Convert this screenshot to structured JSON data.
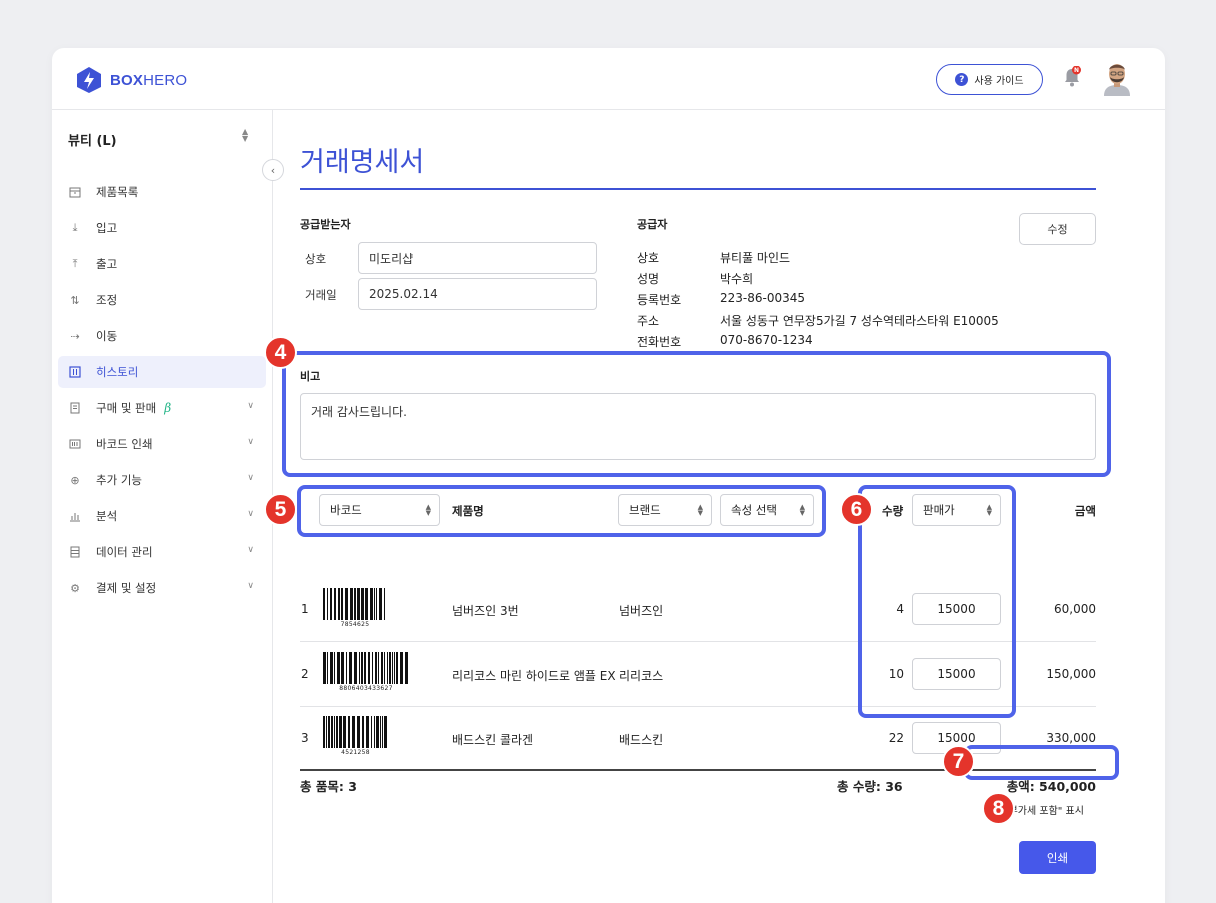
{
  "app": {
    "logo_bold": "BOX",
    "logo_light": "HERO"
  },
  "header": {
    "guide_label": "사용 가이드",
    "notification_badge": "N"
  },
  "sidebar": {
    "store": "뷰티 (L)",
    "items": [
      {
        "label": "제품목록",
        "icon": "box-icon"
      },
      {
        "label": "입고",
        "icon": "arrow-down-icon"
      },
      {
        "label": "출고",
        "icon": "arrow-up-icon"
      },
      {
        "label": "조정",
        "icon": "adjust-icon"
      },
      {
        "label": "이동",
        "icon": "move-icon"
      },
      {
        "label": "히스토리",
        "icon": "history-icon",
        "active": true
      },
      {
        "label": "구매 및 판매",
        "icon": "document-icon",
        "beta": "β",
        "expand": true
      },
      {
        "label": "바코드 인쇄",
        "icon": "barcode-icon",
        "expand": true
      },
      {
        "label": "추가 기능",
        "icon": "plus-circle-icon",
        "expand": true
      },
      {
        "label": "분석",
        "icon": "chart-icon",
        "expand": true
      },
      {
        "label": "데이터 관리",
        "icon": "database-icon",
        "expand": true
      },
      {
        "label": "결제 및 설정",
        "icon": "settings-icon",
        "expand": true
      }
    ]
  },
  "page": {
    "title": "거래명세서",
    "receiver": {
      "section_label": "공급받는자",
      "name_label": "상호",
      "name_value": "미도리샵",
      "date_label": "거래일",
      "date_value": "2025.02.14"
    },
    "supplier": {
      "section_label": "공급자",
      "edit_label": "수정",
      "rows": [
        {
          "k": "상호",
          "v": "뷰티풀 마인드"
        },
        {
          "k": "성명",
          "v": "박수희"
        },
        {
          "k": "등록번호",
          "v": "223-86-00345"
        },
        {
          "k": "주소",
          "v": "서울 성동구 연무장5가길 7 성수역테라스타워 E10005"
        },
        {
          "k": "전화번호",
          "v": "070-8670-1234"
        }
      ]
    },
    "memo": {
      "label": "비고",
      "value": "거래 감사드립니다."
    },
    "table": {
      "barcode_select": "바코드",
      "product_header": "제품명",
      "brand_select": "브랜드",
      "attr_select": "속성 선택",
      "qty_header": "수량",
      "price_select": "판매가",
      "amount_header": "금액",
      "rows": [
        {
          "no": "1",
          "barcode": "7854625",
          "product": "넘버즈인 3번",
          "brand": "넘버즈인",
          "qty": "4",
          "price": "15000",
          "amount": "60,000"
        },
        {
          "no": "2",
          "barcode": "8806403433627",
          "product": "리리코스 마린 하이드로 앰플 EX",
          "brand": "리리코스",
          "qty": "10",
          "price": "15000",
          "amount": "150,000"
        },
        {
          "no": "3",
          "barcode": "4521258",
          "product": "배드스킨 콜라겐",
          "brand": "배드스킨",
          "qty": "22",
          "price": "15000",
          "amount": "330,000"
        }
      ]
    },
    "totals": {
      "items": "총 품목: 3",
      "qty": "총 수량: 36",
      "amount": "총액: 540,000"
    },
    "vat_label": "\"부가세 포함\" 표시",
    "print_label": "인쇄"
  },
  "annotations": [
    "4",
    "5",
    "6",
    "7",
    "8"
  ],
  "colors": {
    "accent": "#3d52d5",
    "highlight": "#4f63e9",
    "badge": "#e4342b"
  }
}
